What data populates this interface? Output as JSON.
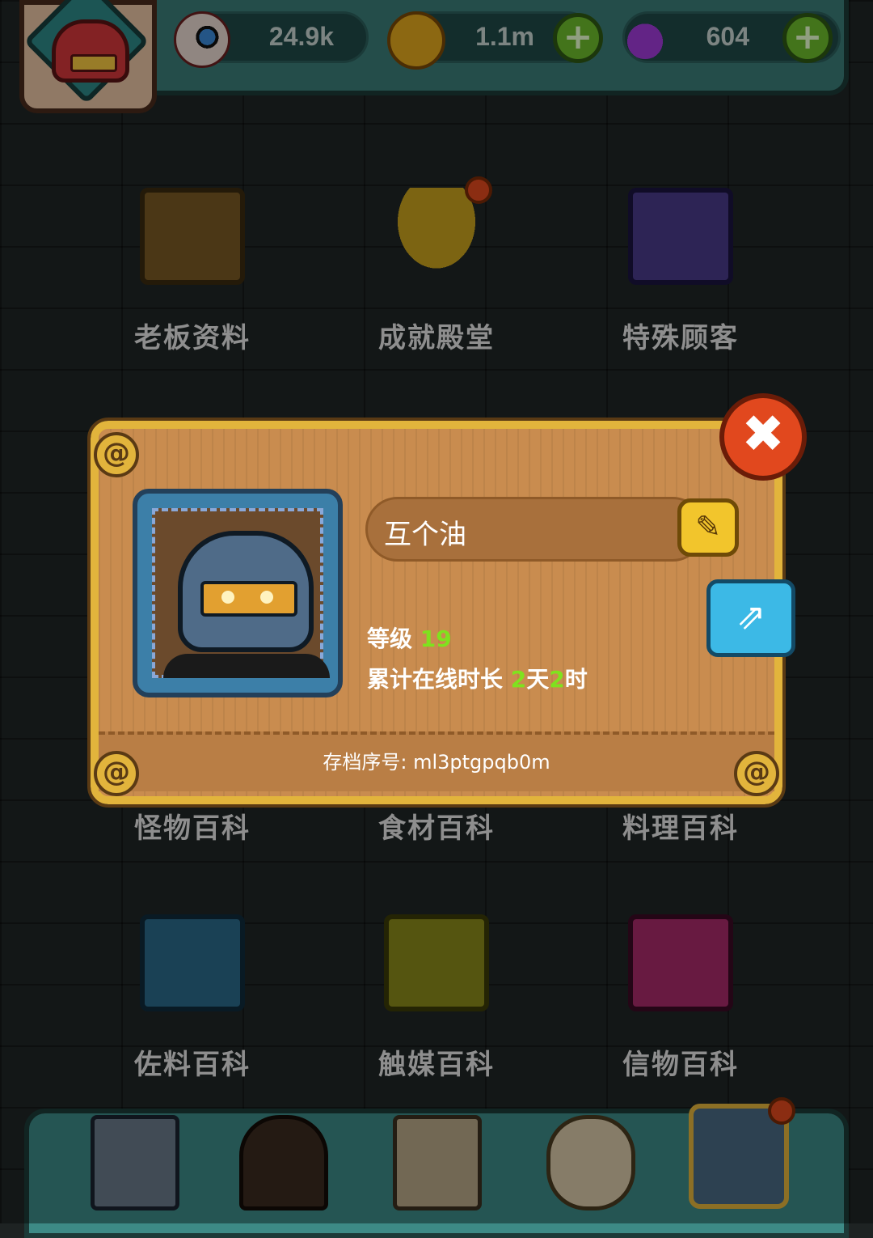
{
  "header": {
    "resources": [
      {
        "name": "eyeball",
        "value": "24.9k"
      },
      {
        "name": "coin",
        "value": "1.1m"
      },
      {
        "name": "potion",
        "value": "604"
      }
    ],
    "plus_label": "+"
  },
  "menu": {
    "row1": [
      "老板资料",
      "成就殿堂",
      "特殊顾客"
    ],
    "row2": [
      "怪物百科",
      "食材百科",
      "料理百科"
    ],
    "row3": [
      "佐料百科",
      "触媒百科",
      "信物百科"
    ]
  },
  "dialog": {
    "player_name": "互个油",
    "level_label": "等级",
    "level_value": "19",
    "online_label": "累计在线时长",
    "online_days": "2",
    "online_days_unit": "天",
    "online_hours": "2",
    "online_hours_unit": "时",
    "serial_label": "存档序号:",
    "serial_value": "ml3ptgpqb0m",
    "close_glyph": "✖",
    "edit_glyph": "✎",
    "share_glyph": "⇗",
    "corner_glyph": "@"
  },
  "colors": {
    "accent_green": "#7fe21e",
    "frame_gold": "#e2b43c",
    "close_red": "#e1481e"
  }
}
